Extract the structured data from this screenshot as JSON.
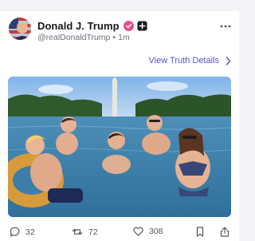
{
  "post": {
    "display_name": "Donald J. Trump",
    "handle": "@realDonaldTrump",
    "separator": "•",
    "time_ago": "1m",
    "view_link": "View Truth Details"
  },
  "actions": {
    "replies": "32",
    "retruths": "72",
    "likes": "308"
  },
  "icons": {
    "avatar": "flag-portrait-avatar",
    "verified": "verified-check-icon",
    "follow": "plus-icon",
    "more": "more-dots-icon",
    "chevron": "chevron-right-icon",
    "reply": "reply-bubble-icon",
    "retruth": "retruth-arrows-icon",
    "like": "heart-icon",
    "bookmark": "bookmark-icon",
    "share": "share-icon"
  },
  "colors": {
    "accent": "#5a52c9",
    "verified": "#e64d8c",
    "text": "#17171c",
    "muted": "#6d6d78"
  }
}
